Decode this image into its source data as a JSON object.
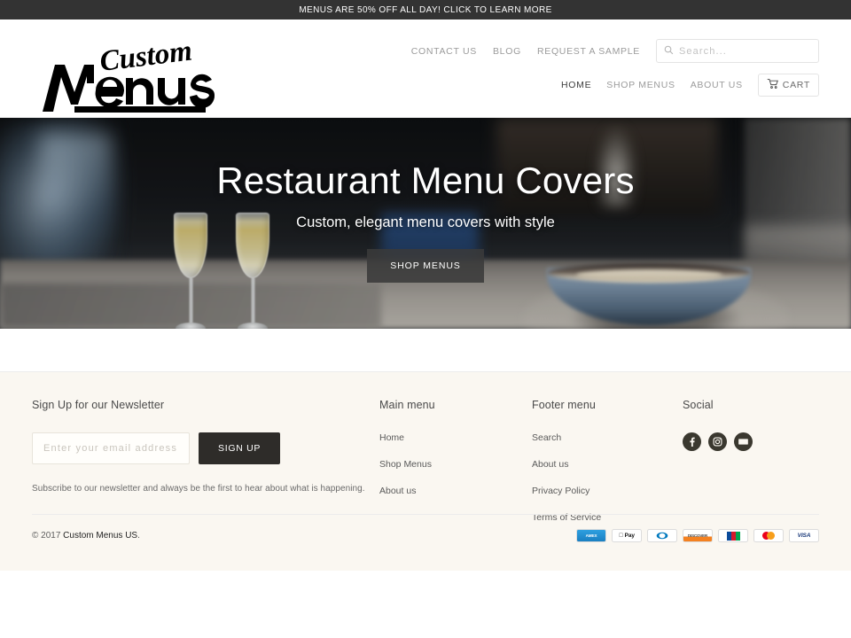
{
  "announcement": {
    "text": "MENUS ARE 50% OFF ALL DAY! CLICK TO LEARN MORE"
  },
  "header": {
    "logo_line1": "Custom",
    "logo_line2": "Menus",
    "top_links": [
      {
        "label": "CONTACT US"
      },
      {
        "label": "BLOG"
      },
      {
        "label": "REQUEST A SAMPLE"
      }
    ],
    "search": {
      "placeholder": "Search...",
      "value": ""
    },
    "nav": [
      {
        "label": "HOME",
        "active": true
      },
      {
        "label": "SHOP MENUS",
        "active": false
      },
      {
        "label": "ABOUT US",
        "active": false
      }
    ],
    "cart_label": "CART"
  },
  "hero": {
    "title": "Restaurant Menu Covers",
    "subtitle": "Custom, elegant menu covers with style",
    "button_label": "SHOP MENUS"
  },
  "footer": {
    "newsletter": {
      "heading": "Sign Up for our Newsletter",
      "email_placeholder": "Enter your email address...",
      "email_value": "",
      "button_label": "SIGN UP",
      "note": "Subscribe to our newsletter and always be the first to hear about what is happening."
    },
    "main_menu": {
      "heading": "Main menu",
      "items": [
        {
          "label": "Home"
        },
        {
          "label": "Shop Menus"
        },
        {
          "label": "About us"
        }
      ]
    },
    "footer_menu": {
      "heading": "Footer menu",
      "items": [
        {
          "label": "Search"
        },
        {
          "label": "About us"
        },
        {
          "label": "Privacy Policy"
        },
        {
          "label": "Terms of Service"
        }
      ]
    },
    "social": {
      "heading": "Social",
      "items": [
        {
          "name": "facebook-icon"
        },
        {
          "name": "instagram-icon"
        },
        {
          "name": "email-icon"
        }
      ]
    },
    "copyright_prefix": "© 2017 ",
    "copyright_store": "Custom Menus US",
    "copyright_suffix": ".",
    "payments": [
      {
        "label": "AMERICAN EXPRESS",
        "key": "amex"
      },
      {
        "label": "Pay",
        "key": "apple-pay"
      },
      {
        "label": "Diners Club",
        "key": "diners"
      },
      {
        "label": "DISCOVER",
        "key": "discover"
      },
      {
        "label": "JCB",
        "key": "jcb"
      },
      {
        "label": "Mastercard",
        "key": "mastercard"
      },
      {
        "label": "VISA",
        "key": "visa"
      }
    ]
  },
  "colors": {
    "announce_bg": "#333333",
    "footer_bg": "#faf7f1",
    "accent_dark": "#2e2c29",
    "social_bg": "#3a382f"
  }
}
